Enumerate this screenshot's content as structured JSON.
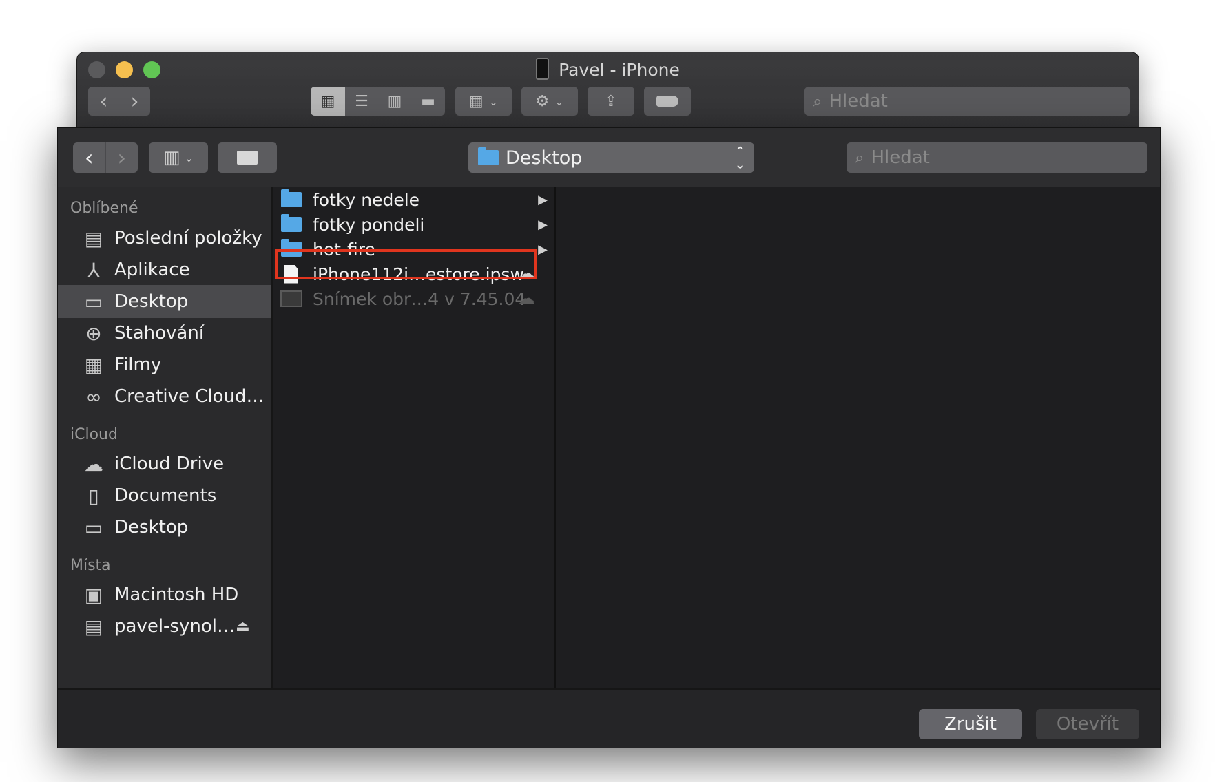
{
  "finder_window": {
    "title": "Pavel - iPhone",
    "search_placeholder": "Hledat"
  },
  "dialog": {
    "location": "Desktop",
    "search_placeholder": "Hledat",
    "sidebar": {
      "sections": [
        {
          "heading": "Oblíbené",
          "items": [
            {
              "label": "Poslední položky",
              "icon": "recents-icon"
            },
            {
              "label": "Aplikace",
              "icon": "applications-icon"
            },
            {
              "label": "Desktop",
              "icon": "desktop-icon",
              "selected": true
            },
            {
              "label": "Stahování",
              "icon": "downloads-icon"
            },
            {
              "label": "Filmy",
              "icon": "movies-icon"
            },
            {
              "label": "Creative Cloud…",
              "icon": "creative-cloud-icon"
            }
          ]
        },
        {
          "heading": "iCloud",
          "items": [
            {
              "label": "iCloud Drive",
              "icon": "cloud-icon"
            },
            {
              "label": "Documents",
              "icon": "documents-icon"
            },
            {
              "label": "Desktop",
              "icon": "desktop-icon"
            }
          ]
        },
        {
          "heading": "Místa",
          "items": [
            {
              "label": "Macintosh HD",
              "icon": "hard-drive-icon"
            },
            {
              "label": "pavel-synol…",
              "icon": "network-drive-icon"
            }
          ]
        }
      ]
    },
    "files": [
      {
        "name": "fotky nedele",
        "type": "folder"
      },
      {
        "name": "fotky pondeli",
        "type": "folder"
      },
      {
        "name": "hot-fire",
        "type": "folder"
      },
      {
        "name": "iPhone112i…estore.ipsw",
        "type": "file",
        "highlighted": true
      },
      {
        "name": "Snímek obr…4 v 7.45.04",
        "type": "screenshot",
        "disabled": true
      }
    ],
    "buttons": {
      "cancel": "Zrušit",
      "open": "Otevřít"
    }
  },
  "colors": {
    "highlight_border": "#e0351e",
    "folder": "#55a8e6"
  }
}
